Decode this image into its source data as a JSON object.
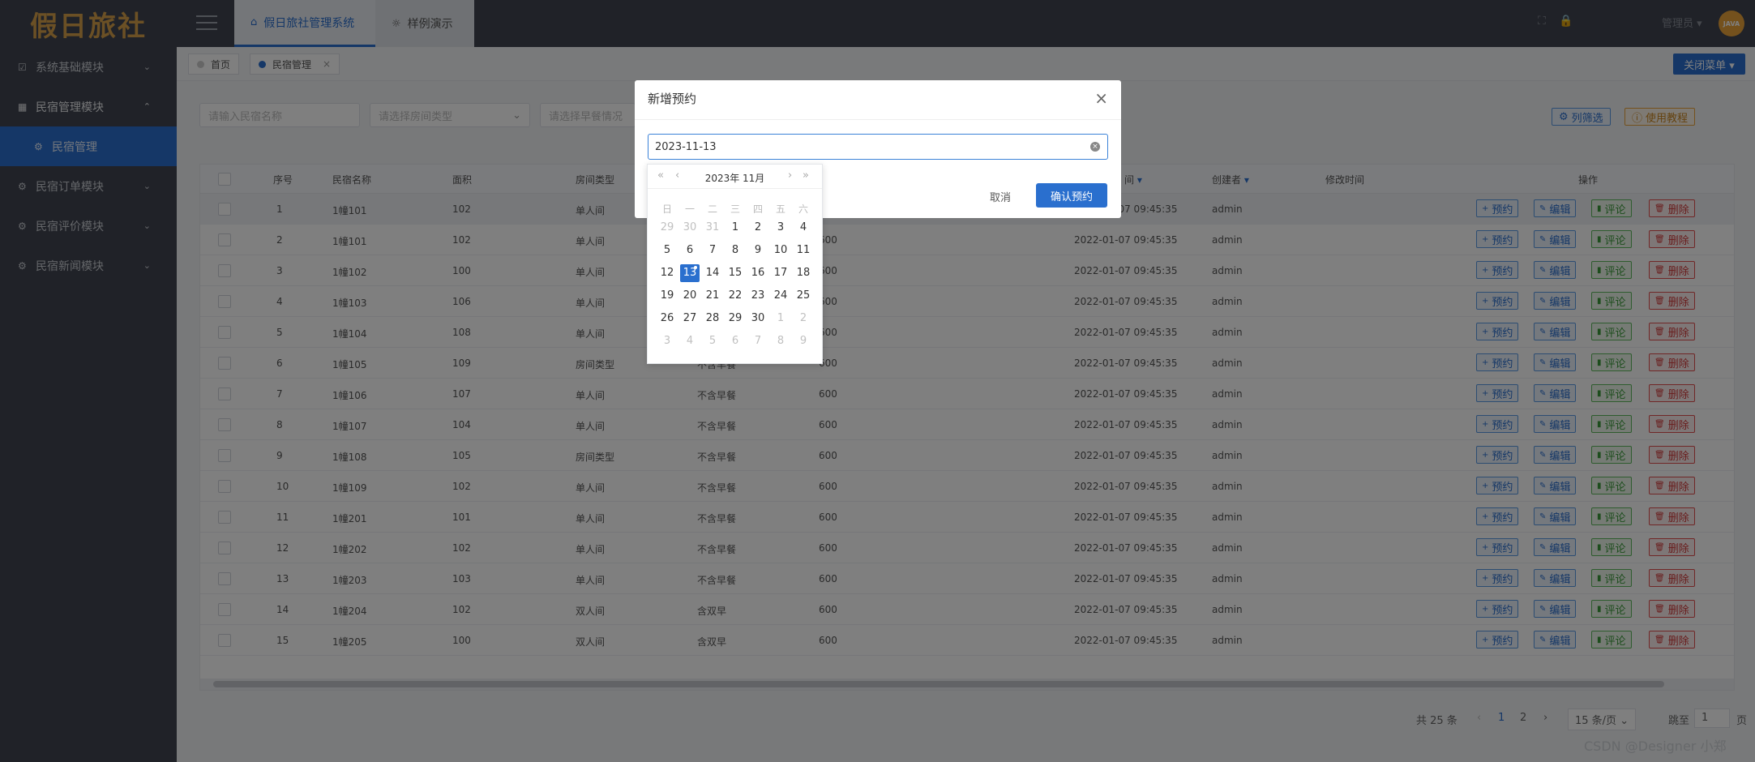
{
  "app": {
    "logo": "假日旅社"
  },
  "topbar": {
    "tabs": [
      {
        "label": "假日旅社管理系统"
      },
      {
        "label": "样例演示"
      }
    ],
    "user": "管理员 ▾",
    "avatar_text": "JAVA"
  },
  "sidebar": {
    "items": [
      {
        "label": "系统基础模块"
      },
      {
        "label": "民宿管理模块"
      },
      {
        "label": "民宿管理"
      },
      {
        "label": "民宿订单模块"
      },
      {
        "label": "民宿评价模块"
      },
      {
        "label": "民宿新闻模块"
      }
    ]
  },
  "page_tabs": [
    {
      "label": "首页"
    },
    {
      "label": "民宿管理"
    }
  ],
  "close_menu": "关闭菜单 ▾",
  "filters": {
    "name_placeholder": "请输入民宿名称",
    "room_type_placeholder": "请选择房间类型",
    "breakfast_placeholder": "请选择早餐情况"
  },
  "toolbar": {
    "filter_columns": "列筛选",
    "tutorial": "使用教程"
  },
  "table": {
    "headers": [
      "序号",
      "民宿名称",
      "面积",
      "房间类型",
      "间",
      "创建者",
      "修改时间",
      "操作"
    ],
    "actions": {
      "book": "预约",
      "edit": "编辑",
      "comment": "评论",
      "delete": "删除"
    },
    "rows": [
      {
        "no": "1",
        "name": "1幢101",
        "area": "102",
        "type": "单人间",
        "breakfast": "",
        "price": "",
        "created": "2022-01-07 09:45:35",
        "creator": "admin"
      },
      {
        "no": "2",
        "name": "1幢101",
        "area": "102",
        "type": "单人间",
        "breakfast": "",
        "price": "600",
        "created": "2022-01-07 09:45:35",
        "creator": "admin"
      },
      {
        "no": "3",
        "name": "1幢102",
        "area": "100",
        "type": "单人间",
        "breakfast": "",
        "price": "600",
        "created": "2022-01-07 09:45:35",
        "creator": "admin"
      },
      {
        "no": "4",
        "name": "1幢103",
        "area": "106",
        "type": "单人间",
        "breakfast": "",
        "price": "600",
        "created": "2022-01-07 09:45:35",
        "creator": "admin"
      },
      {
        "no": "5",
        "name": "1幢104",
        "area": "108",
        "type": "单人间",
        "breakfast": "",
        "price": "600",
        "created": "2022-01-07 09:45:35",
        "creator": "admin"
      },
      {
        "no": "6",
        "name": "1幢105",
        "area": "109",
        "type": "房间类型",
        "breakfast": "不含早餐",
        "price": "600",
        "created": "2022-01-07 09:45:35",
        "creator": "admin"
      },
      {
        "no": "7",
        "name": "1幢106",
        "area": "107",
        "type": "单人间",
        "breakfast": "不含早餐",
        "price": "600",
        "created": "2022-01-07 09:45:35",
        "creator": "admin"
      },
      {
        "no": "8",
        "name": "1幢107",
        "area": "104",
        "type": "单人间",
        "breakfast": "不含早餐",
        "price": "600",
        "created": "2022-01-07 09:45:35",
        "creator": "admin"
      },
      {
        "no": "9",
        "name": "1幢108",
        "area": "105",
        "type": "房间类型",
        "breakfast": "不含早餐",
        "price": "600",
        "created": "2022-01-07 09:45:35",
        "creator": "admin"
      },
      {
        "no": "10",
        "name": "1幢109",
        "area": "102",
        "type": "单人间",
        "breakfast": "不含早餐",
        "price": "600",
        "created": "2022-01-07 09:45:35",
        "creator": "admin"
      },
      {
        "no": "11",
        "name": "1幢201",
        "area": "101",
        "type": "单人间",
        "breakfast": "不含早餐",
        "price": "600",
        "created": "2022-01-07 09:45:35",
        "creator": "admin"
      },
      {
        "no": "12",
        "name": "1幢202",
        "area": "102",
        "type": "单人间",
        "breakfast": "不含早餐",
        "price": "600",
        "created": "2022-01-07 09:45:35",
        "creator": "admin"
      },
      {
        "no": "13",
        "name": "1幢203",
        "area": "103",
        "type": "单人间",
        "breakfast": "不含早餐",
        "price": "600",
        "created": "2022-01-07 09:45:35",
        "creator": "admin"
      },
      {
        "no": "14",
        "name": "1幢204",
        "area": "102",
        "type": "双人间",
        "breakfast": "含双早",
        "price": "600",
        "created": "2022-01-07 09:45:35",
        "creator": "admin"
      },
      {
        "no": "15",
        "name": "1幢205",
        "area": "100",
        "type": "双人间",
        "breakfast": "含双早",
        "price": "600",
        "created": "2022-01-07 09:45:35",
        "creator": "admin"
      }
    ]
  },
  "pagination": {
    "total": "共 25 条",
    "pages": [
      "1",
      "2"
    ],
    "page_size": "15 条/页",
    "jump_label": "跳至",
    "jump_value": "1",
    "page_unit": "页"
  },
  "modal": {
    "title": "新增预约",
    "date_value": "2023-11-13",
    "cancel": "取消",
    "confirm": "确认预约"
  },
  "calendar": {
    "title": "2023年 11月",
    "weekdays": [
      "日",
      "一",
      "二",
      "三",
      "四",
      "五",
      "六"
    ],
    "weeks": [
      [
        "29",
        "30",
        "31",
        "1",
        "2",
        "3",
        "4"
      ],
      [
        "5",
        "6",
        "7",
        "8",
        "9",
        "10",
        "11"
      ],
      [
        "12",
        "13",
        "14",
        "15",
        "16",
        "17",
        "18"
      ],
      [
        "19",
        "20",
        "21",
        "22",
        "23",
        "24",
        "25"
      ],
      [
        "26",
        "27",
        "28",
        "29",
        "30",
        "1",
        "2"
      ],
      [
        "3",
        "4",
        "5",
        "6",
        "7",
        "8",
        "9"
      ]
    ],
    "selected": "13"
  },
  "watermark": "CSDN @Designer 小郑"
}
